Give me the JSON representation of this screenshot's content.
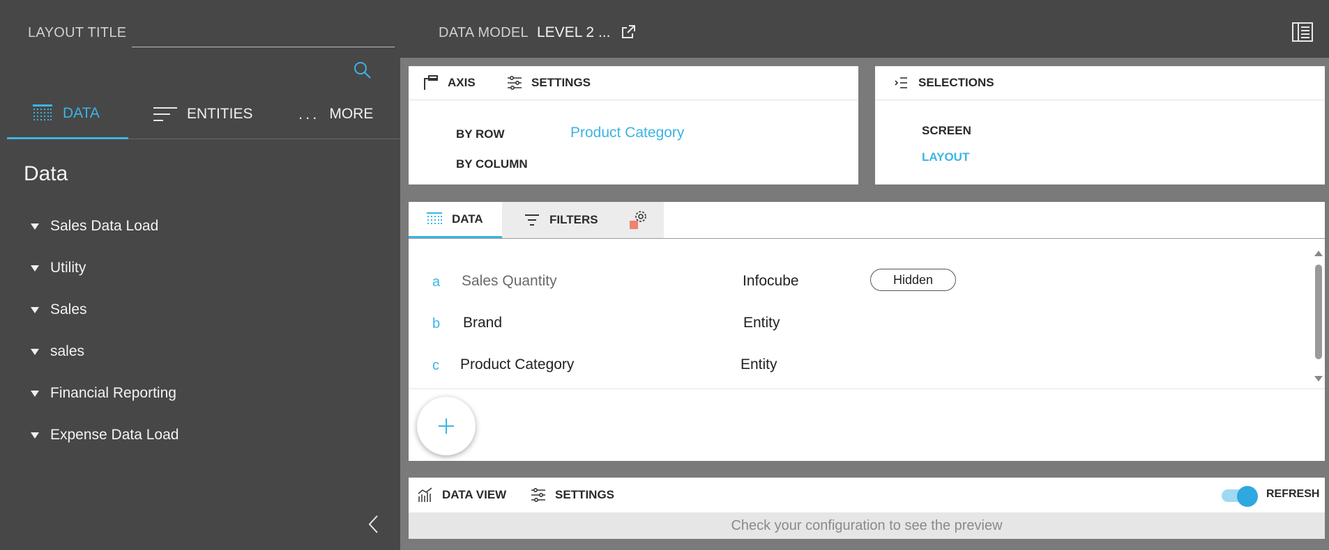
{
  "topbar": {
    "layout_title_label": "LAYOUT TITLE",
    "layout_title_value": "",
    "data_model_label": "DATA MODEL",
    "data_model_value": "LEVEL 2 ..."
  },
  "sidebar": {
    "tabs": [
      {
        "label": "DATA",
        "icon": "data-grid-icon",
        "active": true
      },
      {
        "label": "ENTITIES",
        "icon": "entities-list-icon",
        "active": false
      },
      {
        "label": "MORE",
        "icon": "more-dots-icon",
        "active": false
      }
    ],
    "more_dots": "...",
    "heading": "Data",
    "items": [
      {
        "label": "Sales Data Load"
      },
      {
        "label": "Utility"
      },
      {
        "label": "Sales"
      },
      {
        "label": "sales"
      },
      {
        "label": "Financial Reporting"
      },
      {
        "label": "Expense Data Load"
      }
    ]
  },
  "axis_panel": {
    "axis_label": "AXIS",
    "settings_label": "SETTINGS",
    "by_row_label": "BY ROW",
    "by_row_value": "Product Category",
    "by_column_label": "BY COLUMN"
  },
  "selections_panel": {
    "label": "SELECTIONS",
    "screen_label": "SCREEN",
    "layout_label": "LAYOUT"
  },
  "data_panel": {
    "tabs": [
      {
        "label": "DATA",
        "active": true
      },
      {
        "label": "FILTERS",
        "active": false
      }
    ],
    "rows": [
      {
        "letter": "a",
        "name": "Sales Quantity",
        "type": "Infocube",
        "badge": "Hidden"
      },
      {
        "letter": "b",
        "name": "Brand",
        "type": "Entity"
      },
      {
        "letter": "c",
        "name": "Product Category",
        "type": "Entity"
      }
    ]
  },
  "preview_panel": {
    "data_view_label": "DATA VIEW",
    "settings_label": "SETTINGS",
    "refresh_label": "REFRESH",
    "refresh_on": true,
    "message": "Check your configuration to see the preview"
  },
  "colors": {
    "accent": "#3cb4e5",
    "dark_bg": "#474747",
    "canvas": "#7a7a7a",
    "warning_square": "#f08070"
  }
}
